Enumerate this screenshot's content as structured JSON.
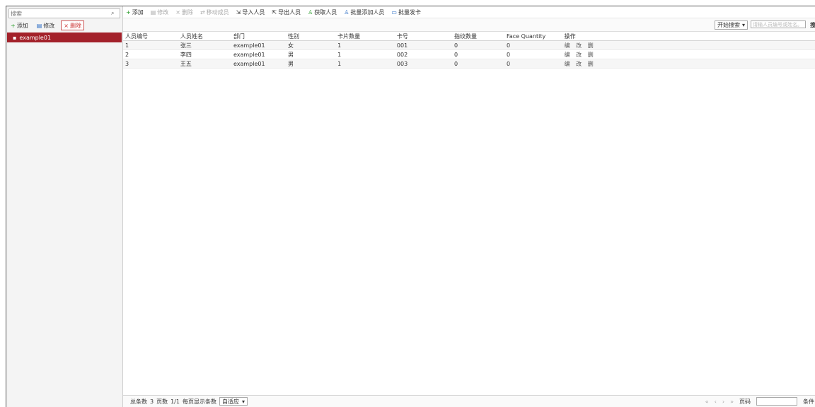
{
  "left_panel": {
    "search_placeholder": "搜索",
    "tools": {
      "add": "添加",
      "edit": "修改",
      "delete": "删除"
    },
    "tree_item": "example01"
  },
  "toolbar": {
    "add": "添加",
    "edit": "修改",
    "delete": "删除",
    "move": "移动成员",
    "import": "导入人员",
    "export": "导出人员",
    "sync": "获取人员",
    "batch_add": "批量添加人员",
    "batch_card": "批量发卡"
  },
  "query": {
    "field": "开始搜索",
    "input_placeholder": "请输人员编号或姓名。",
    "button": "搜"
  },
  "table": {
    "headers": [
      "人员编号",
      "人员姓名",
      "部门",
      "性别",
      "卡片数量",
      "卡号",
      "指纹数量",
      "Face Quantity",
      "操作"
    ],
    "rows": [
      [
        "1",
        "张三",
        "example01",
        "女",
        "1",
        "001",
        "0",
        "0",
        "编 改 删"
      ],
      [
        "2",
        "李四",
        "example01",
        "男",
        "1",
        "002",
        "0",
        "0",
        "编 改 删"
      ],
      [
        "3",
        "王五",
        "example01",
        "男",
        "1",
        "003",
        "0",
        "0",
        "编 改 删"
      ]
    ]
  },
  "footer": {
    "total_label": "总条数",
    "total": "3",
    "page_label": "页数",
    "page": "1/1",
    "per_page_label": "每页显示条数",
    "per_page": "自适应",
    "goto_label": "页码",
    "end_label": "条件"
  }
}
